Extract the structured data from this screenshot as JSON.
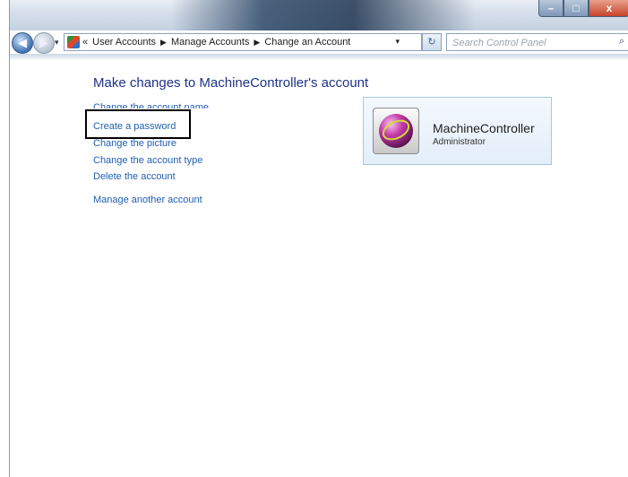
{
  "window": {
    "buttons": {
      "minimize": "–",
      "maximize": "□",
      "close": "x"
    }
  },
  "nav": {
    "back_glyph": "◀",
    "forward_glyph": "▶",
    "breadcrumb_prefix": "«",
    "breadcrumbs": [
      "User Accounts",
      "Manage Accounts",
      "Change an Account"
    ],
    "breadcrumb_separator": "▶",
    "refresh_glyph": "↻",
    "search_placeholder": "Search Control Panel",
    "search_icon": "⌕"
  },
  "main": {
    "title": "Make changes to MachineController's account",
    "tasks": [
      "Change the account name",
      "Create a password",
      "Change the picture",
      "Change the account type",
      "Delete the account",
      "Manage another account"
    ]
  },
  "account": {
    "name": "MachineController",
    "role": "Administrator"
  },
  "colors": {
    "link": "#1f5fb3",
    "title": "#1e3287",
    "card_border": "#a8c7e2",
    "highlight_box": "#000000"
  }
}
